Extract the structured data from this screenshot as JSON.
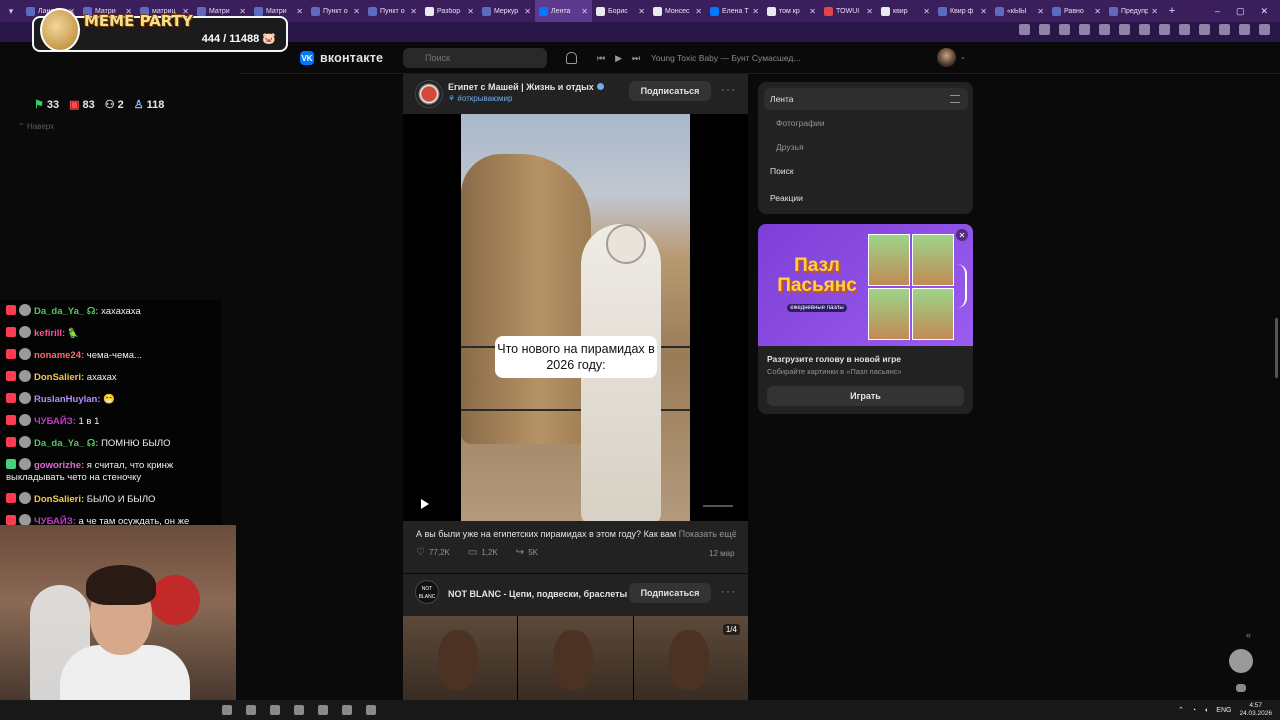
{
  "browser": {
    "tabs": [
      {
        "label": "Лана Бо",
        "fav": "ph"
      },
      {
        "label": "Матри",
        "fav": "ph"
      },
      {
        "label": "матриц",
        "fav": "ph"
      },
      {
        "label": "Матри",
        "fav": "ph"
      },
      {
        "label": "Матри",
        "fav": "ph"
      },
      {
        "label": "Пункт о",
        "fav": "ph"
      },
      {
        "label": "Пункт о",
        "fav": "ph"
      },
      {
        "label": "Разбор",
        "fav": "g"
      },
      {
        "label": "Меркур",
        "fav": "ph"
      },
      {
        "label": "Лента",
        "fav": "vk",
        "active": true
      },
      {
        "label": "Борис",
        "fav": "g"
      },
      {
        "label": "Монсес",
        "fav": "g"
      },
      {
        "label": "Елена Т",
        "fav": "vk"
      },
      {
        "label": "том кр",
        "fav": "g"
      },
      {
        "label": "TOWUI",
        "fav": "red"
      },
      {
        "label": "квир",
        "fav": "g"
      },
      {
        "label": "Квир ф",
        "fav": "ph"
      },
      {
        "label": "«кЫЫ",
        "fav": "ph"
      },
      {
        "label": "Равно",
        "fav": "ph"
      },
      {
        "label": "Предупре",
        "fav": "ph"
      }
    ],
    "new_tab": "+",
    "window_controls": [
      "–",
      "▢",
      "✕"
    ]
  },
  "stream": {
    "widget_title": "MEME PARTY",
    "widget_count": "444 / 11488",
    "stats": [
      {
        "value": "33",
        "color": "g",
        "icon": "flag-icon"
      },
      {
        "value": "83",
        "color": "r",
        "icon": "vk-live-icon"
      },
      {
        "value": "2",
        "color": "w",
        "icon": "user-icon"
      },
      {
        "value": "118",
        "color": "b",
        "icon": "viewers-icon"
      }
    ],
    "back_to_top": "Наверх",
    "chat": [
      {
        "name": "Da_da_Ya_ ☊:",
        "text": "хахахаха",
        "color": "#56c95b"
      },
      {
        "name": "kefirill:",
        "text": "🦜",
        "color": "#ff4f9a"
      },
      {
        "name": "noname24:",
        "text": "чема-чема...",
        "color": "#ff6b6b"
      },
      {
        "name": "DonSalieri:",
        "text": "ахахах",
        "color": "#f2c94c"
      },
      {
        "name": "RuslanHuylan:",
        "text": "😁",
        "color": "#b58bff"
      },
      {
        "name": "ЧУБАЙЗ:",
        "text": "1 в 1",
        "color": "#c13ac9"
      },
      {
        "name": "Da_da_Ya_ ☊:",
        "text": "ПОМНЮ БЫЛО",
        "color": "#56c95b"
      },
      {
        "name": "goworizhe:",
        "text": "я считал, что кринж выкладывать чето на стеночку",
        "color": "#e06ad9",
        "badge": "k"
      },
      {
        "name": "DonSalieri:",
        "text": "БЫЛО И БЫЛО",
        "color": "#f2c94c"
      },
      {
        "name": "ЧУБАЙЗ:",
        "text": "а че там осуждать, он же шампунь давит",
        "color": "#c13ac9"
      }
    ]
  },
  "vk": {
    "logo": "вконтакте",
    "logo_mark": "VK",
    "search": {
      "placeholder": "Поиск"
    },
    "player": {
      "prev": "⏮",
      "play": "▶",
      "next": "⏭",
      "track": "Young Toxic Baby — Бунт Сумасшед..."
    },
    "post1": {
      "author": "Египет с Машей | Жизнь и отдых",
      "tag": "⚘ #открываюмир",
      "subscribe": "Подписаться",
      "more": "···",
      "caption_overlay": "Что нового на пирамидах в 2026 году:",
      "text": "А вы были уже на египетских пирамидах в этом году? Как вам",
      "show_more": "Показать ещё",
      "likes": "77,2K",
      "comments": "1,2K",
      "shares": "5K",
      "date": "12 мар"
    },
    "post2": {
      "author": "NOT BLANC - Цепи, подвески, браслеты",
      "avatar_text": "NOT BLANC",
      "subscribe": "Подписаться",
      "more": "···",
      "counter": "1/4"
    },
    "menu": {
      "items": [
        {
          "label": "Лента",
          "active": true
        },
        {
          "label": "Фотографии",
          "sub": true
        },
        {
          "label": "Друзья",
          "sub": true
        },
        {
          "label": "Поиск"
        },
        {
          "label": "Реакции"
        }
      ]
    },
    "ad": {
      "logo_line1": "Пазл",
      "logo_line2": "Пасьянс",
      "logo_sub": "ежедневные пазлы",
      "title": "Разгрузите голову в новой игре",
      "desc": "Собирайте картинки в «Пазл пасьянс»",
      "button": "Играть",
      "close": "✕"
    }
  },
  "system": {
    "lang": "ENG",
    "time": "4:57",
    "date": "24.03.2026"
  }
}
